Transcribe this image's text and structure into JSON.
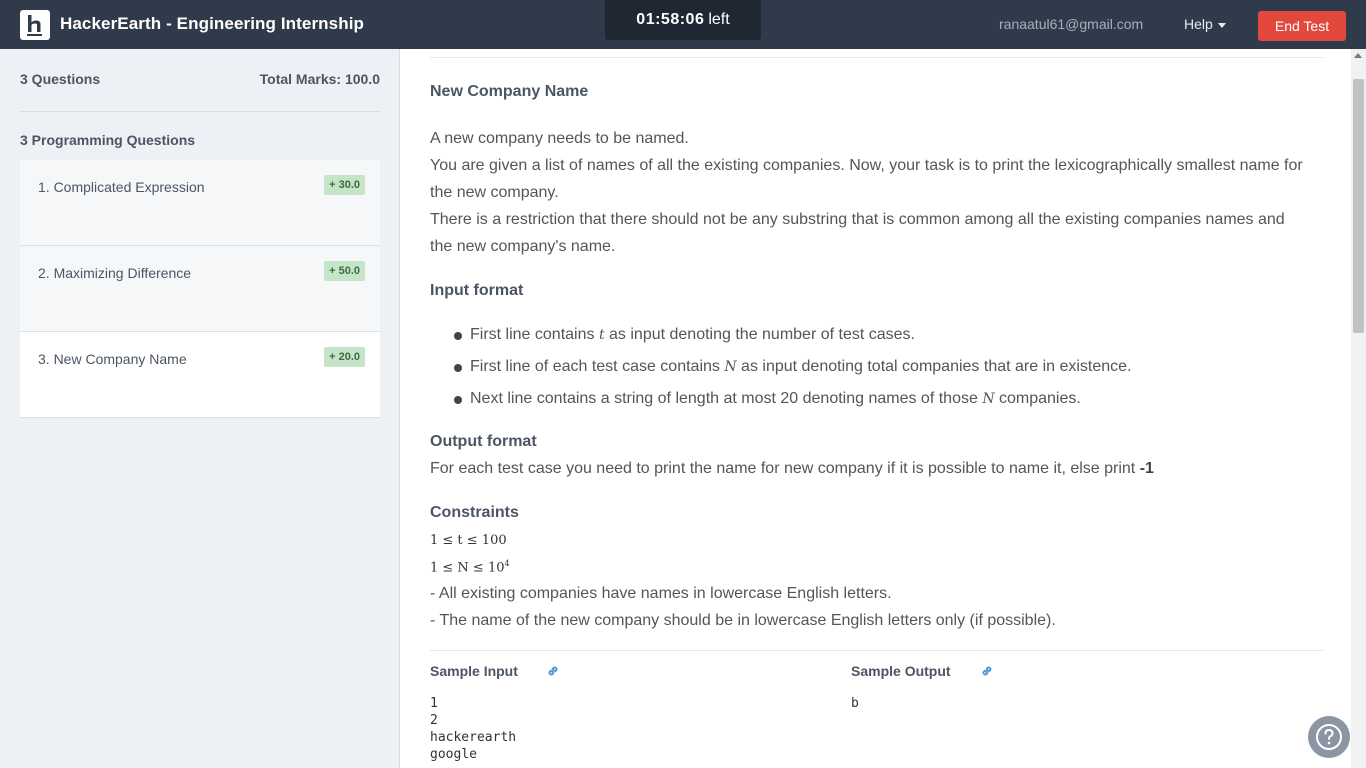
{
  "header": {
    "brand": "HackerEarth - Engineering Internship",
    "timer_value": "01:58:06",
    "timer_suffix": "left",
    "user_email": "ranaatul61@gmail.com",
    "help_label": "Help",
    "end_test_label": "End Test",
    "colors": {
      "bar": "#2f3a4b",
      "end_test": "#e2483b"
    }
  },
  "sidebar": {
    "question_count": "3 Questions",
    "total_marks": "Total Marks: 100.0",
    "section_title": "3 Programming Questions",
    "questions": [
      {
        "title": "1. Complicated Expression",
        "marks": "+ 30.0"
      },
      {
        "title": "2. Maximizing Difference",
        "marks": "+ 50.0"
      },
      {
        "title": "3. New Company Name",
        "marks": "+ 20.0"
      }
    ]
  },
  "problem": {
    "title": "New Company Name",
    "intro": [
      "A new company needs to be named.",
      "You are given a list of names of all the existing companies. Now, your task is to print the lexicographically smallest name for the new company.",
      "There is a restriction that there should not be any substring that is common among all the existing companies names and the new company's name."
    ],
    "input_heading": "Input format",
    "input_items": [
      {
        "pre": "First line contains ",
        "var": "t",
        "post": " as input denoting the number of test cases."
      },
      {
        "pre": "First line of each test case contains ",
        "var": "N",
        "post": " as input denoting total companies that are in existence."
      },
      {
        "pre": "Next line contains a string of length at most 20 denoting names of those ",
        "var": "N",
        "post": " companies."
      }
    ],
    "output_heading": "Output format",
    "output_text": "For each test case you need to print the name for new company if it is possible to name it, else print ",
    "output_strong": "-1",
    "constraints_heading": "Constraints",
    "constraint_t": "1 ≤ t ≤ 100",
    "constraint_n_base": "1 ≤ N ≤ 10",
    "constraint_n_exp": "4",
    "constraint_notes": [
      "- All existing companies have names in lowercase English letters.",
      "- The name of the new company should be in lowercase English letters only (if possible)."
    ],
    "sample_input_label": "Sample Input",
    "sample_output_label": "Sample Output",
    "sample_input": "1\n2\nhackerearth\ngoogle",
    "sample_output": "b"
  },
  "icons": [
    "logo-icon",
    "caret-down-icon",
    "link-icon",
    "question-circle-icon",
    "scroll-up-arrow-icon"
  ]
}
